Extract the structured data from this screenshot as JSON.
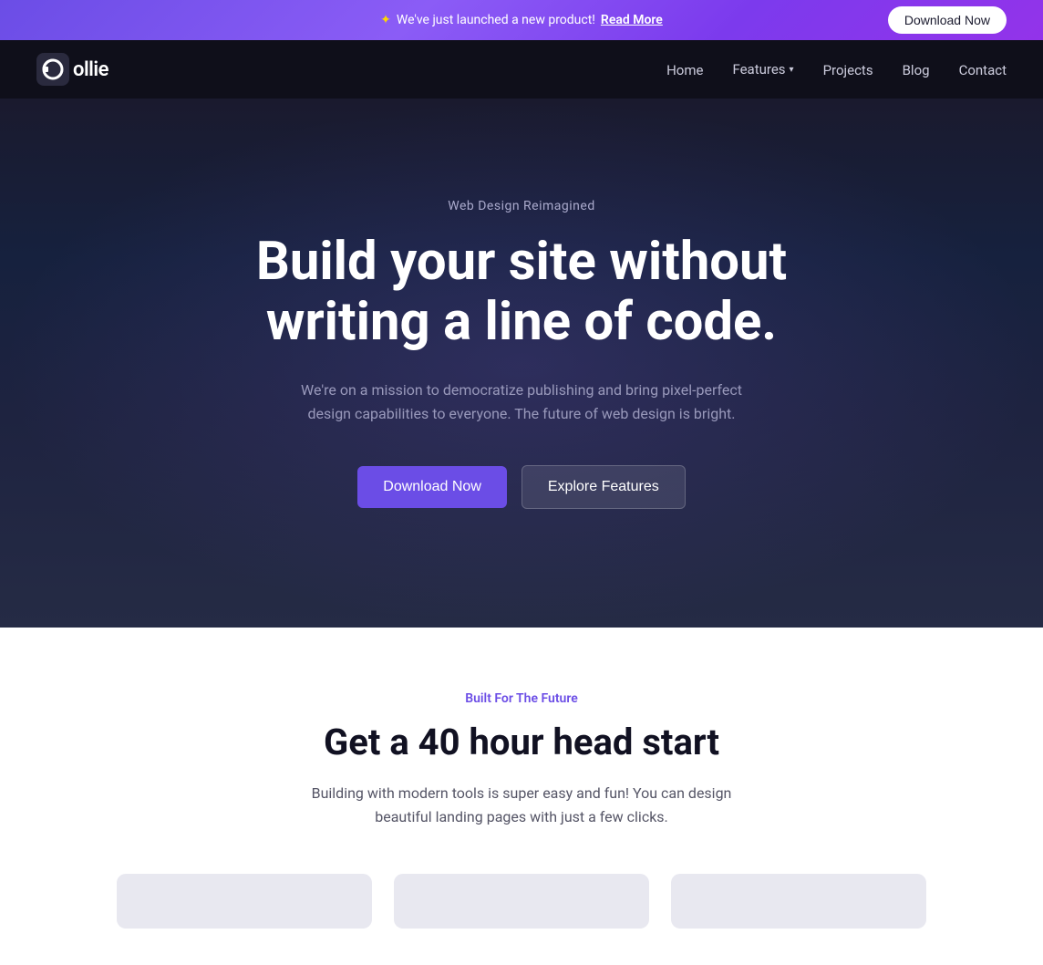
{
  "announcement": {
    "star": "✦",
    "text": "We've just launched a new product!",
    "link_text": "Read More",
    "button_label": "Download Now"
  },
  "navbar": {
    "logo_text": "ollie",
    "nav_items": [
      {
        "label": "Home",
        "has_dropdown": false
      },
      {
        "label": "Features",
        "has_dropdown": true
      },
      {
        "label": "Projects",
        "has_dropdown": false
      },
      {
        "label": "Blog",
        "has_dropdown": false
      },
      {
        "label": "Contact",
        "has_dropdown": false
      }
    ]
  },
  "hero": {
    "subtitle": "Web Design Reimagined",
    "title": "Build your site without writing a line of code.",
    "description": "We're on a mission to democratize publishing and bring pixel-perfect design capabilities to everyone. The future of web design is bright.",
    "primary_button": "Download Now",
    "secondary_button": "Explore Features"
  },
  "features": {
    "tag": "Built For The Future",
    "title": "Get a 40 hour head start",
    "description": "Building with modern tools is super easy and fun! You can design beautiful landing pages with just a few clicks.",
    "cards": [
      {
        "id": "card-1"
      },
      {
        "id": "card-2"
      },
      {
        "id": "card-3"
      }
    ]
  }
}
